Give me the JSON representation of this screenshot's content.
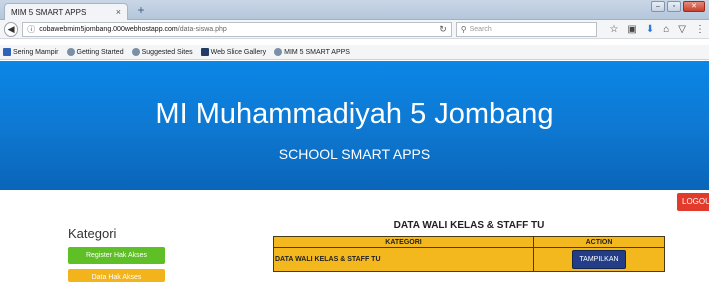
{
  "browser": {
    "tab_title": "MIM 5 SMART APPS",
    "tab_close": "×",
    "new_tab": "+",
    "url_host": "cobawebmim5jombang.000webhostapp.com",
    "url_path": "/data-siswa.php",
    "search_placeholder": "Search",
    "bookmarks": [
      {
        "label": "Sering Mampir",
        "icon": "bookmark-icon"
      },
      {
        "label": "Getting Started",
        "icon": "firefox-icon"
      },
      {
        "label": "Suggested Sites",
        "icon": "firefox-icon"
      },
      {
        "label": "Web Slice Gallery",
        "icon": "ie-icon"
      },
      {
        "label": "MIM 5 SMART APPS",
        "icon": "firefox-icon"
      }
    ]
  },
  "header": {
    "title": "MI Muhammadiyah 5 Jombang",
    "subtitle": "SCHOOL SMART APPS"
  },
  "logout_label": "LOGOU",
  "sidebar": {
    "title": "Kategori",
    "buttons": [
      {
        "label": "Register Hak Akses",
        "color": "#5fbf26"
      },
      {
        "label": "Data Hak Akses",
        "color": "#f3b31a"
      }
    ]
  },
  "main": {
    "section_title": "DATA WALI KELAS & STAFF TU",
    "table": {
      "headers": [
        "KATEGORI",
        "ACTION"
      ],
      "rows": [
        {
          "kategori": "DATA WALI KELAS & STAFF TU",
          "action": "TAMPILKAN"
        }
      ]
    }
  },
  "colors": {
    "hero_blue": "#0b7fd9",
    "table_bg": "#f4b81f",
    "action_button": "#233d86",
    "logout": "#e23b2b"
  }
}
